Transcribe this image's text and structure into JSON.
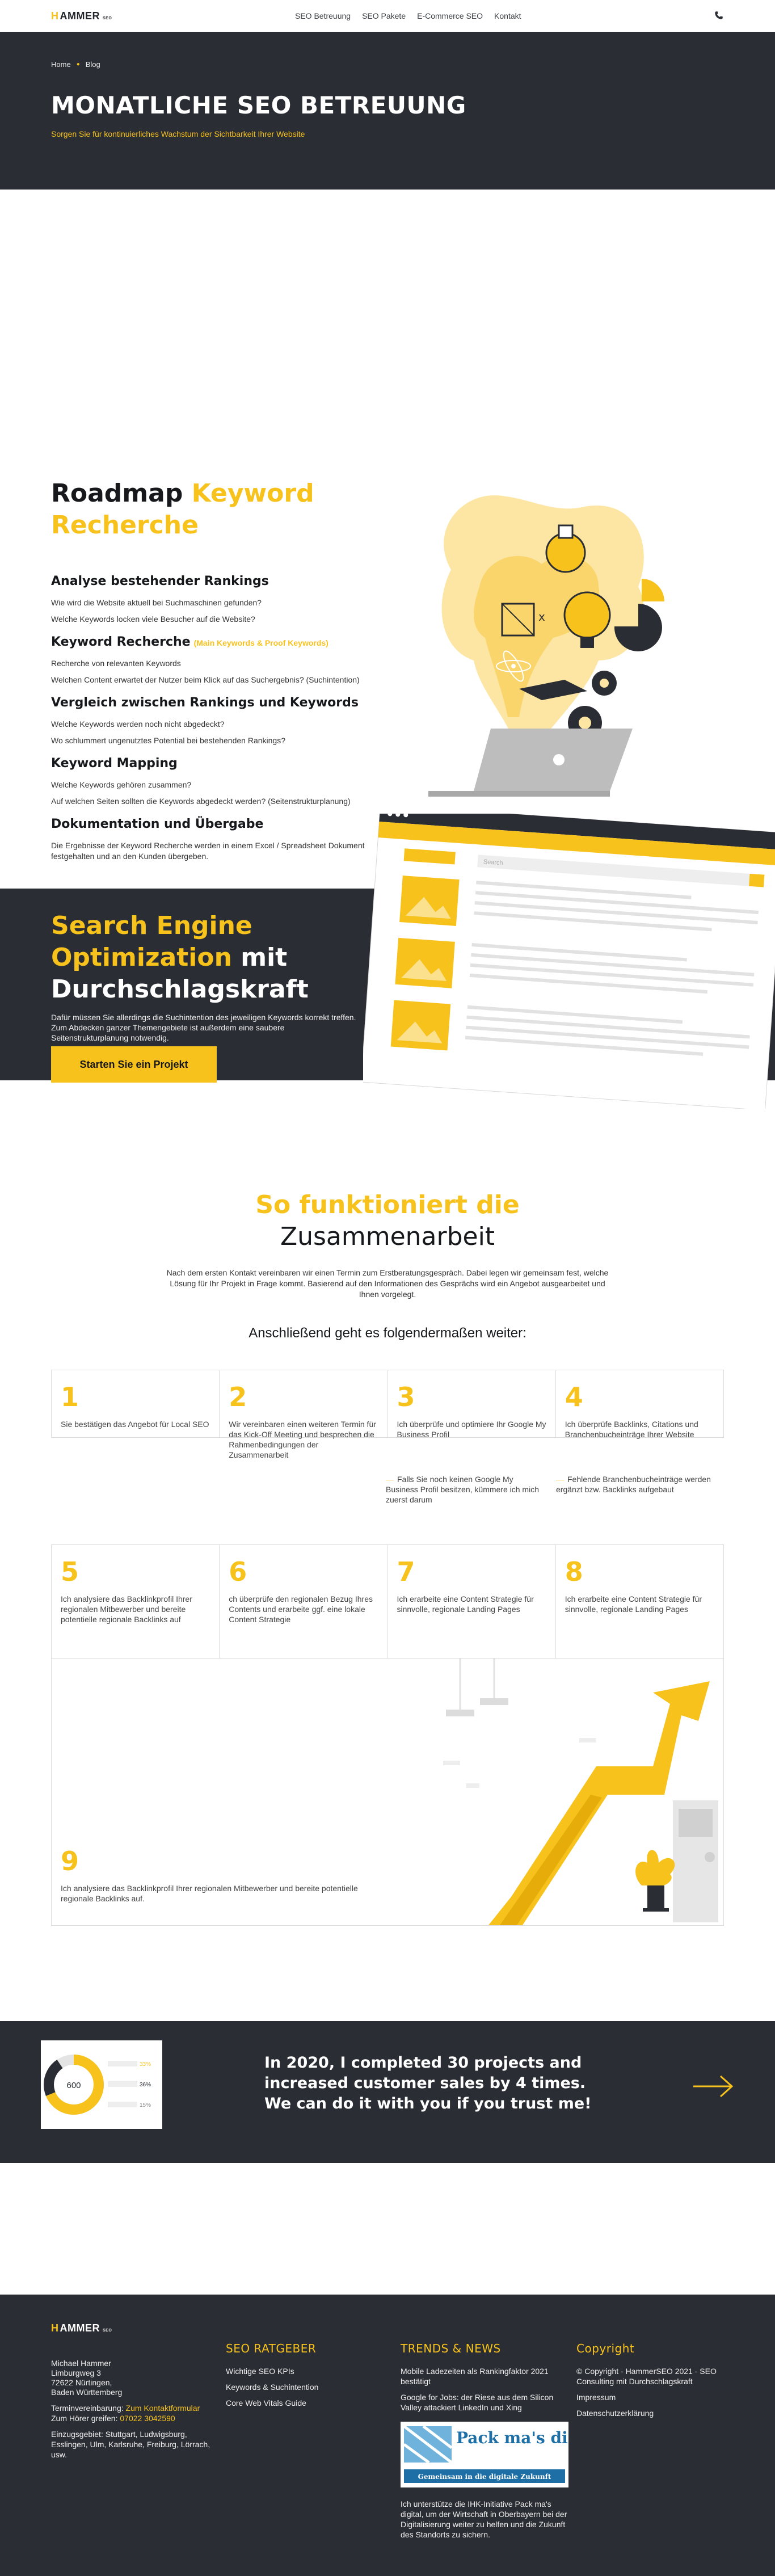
{
  "nav": {
    "logo": "HAMMER",
    "logo_sup": "SEO",
    "links": [
      "SEO Betreuung",
      "SEO Pakete",
      "E-Commerce SEO",
      "Kontakt"
    ]
  },
  "hero": {
    "breadcrumb": [
      "Home",
      "Blog"
    ],
    "title": "MONATLICHE SEO BETREUUNG",
    "subtitle": "Sorgen Sie für kontinuierliches Wachstum der Sichtbarkeit Ihrer Website"
  },
  "roadmap": {
    "title_plain": "Roadmap",
    "title_accent": "Keyword Recherche",
    "items": [
      {
        "heading": "Analyse bestehender Rankings",
        "tag": "",
        "lines": [
          "Wie wird die Website aktuell bei Suchmaschinen gefunden?",
          "Welche Keywords locken viele Besucher auf die Website?"
        ]
      },
      {
        "heading": "Keyword Recherche",
        "tag": "(Main Keywords & Proof Keywords)",
        "lines": [
          "Recherche von relevanten Keywords",
          "Welchen Content erwartet der Nutzer beim Klick auf das Suchergebnis? (Suchintention)"
        ]
      },
      {
        "heading": "Vergleich zwischen Rankings und Keywords",
        "tag": "",
        "lines": [
          "Welche Keywords werden noch nicht abgedeckt?",
          "Wo schlummert ungenutztes Potential bei bestehenden Rankings?"
        ]
      },
      {
        "heading": "Keyword Mapping",
        "tag": "",
        "lines": [
          "Welche Keywords gehören zusammen?",
          "Auf welchen Seiten sollten die Keywords abgedeckt werden? (Seitenstrukturplanung)"
        ]
      },
      {
        "heading": "Dokumentation und Übergabe",
        "tag": "",
        "lines": [
          "Die Ergebnisse der Keyword Recherche werden in einem Excel / Spreadsheet Dokument festgehalten und an den Kunden übergeben."
        ]
      }
    ]
  },
  "seo": {
    "title_accent": "Search Engine Optimization",
    "title_plain": "mit Durchschlagskraft",
    "text": "Dafür müssen Sie allerdings die Suchintention des jeweiligen Keywords korrekt treffen. Zum Abdecken ganzer Themengebiete ist außerdem eine saubere Seitenstrukturplanung notwendig.",
    "cta": "Starten Sie ein Projekt",
    "search_placeholder": "Search"
  },
  "how": {
    "title_accent": "So funktioniert die",
    "title_plain": "Zusammenarbeit",
    "intro": "Nach dem ersten Kontakt vereinbaren wir einen Termin zum Erstberatungsgespräch. Dabei legen wir gemeinsam fest, welche Lösung für Ihr Projekt in Frage kommt. Basierend auf den Informationen des Gesprächs wird ein Angebot ausgearbeitet und Ihnen vorgelegt.",
    "subtitle": "Anschließend geht es folgendermaßen weiter:",
    "steps_row1": [
      {
        "num": "1",
        "text": "Sie bestätigen das Angebot für Local SEO"
      },
      {
        "num": "2",
        "text": "Wir vereinbaren einen weiteren Termin für das Kick-Off Meeting und besprechen die Rahmenbedingungen der Zusammenarbeit"
      },
      {
        "num": "3",
        "text": "Ich überprüfe und optimiere Ihr Google My Business Profil"
      },
      {
        "num": "4",
        "text": "Ich überprüfe Backlinks, Citations und Branchenbucheinträge Ihrer Website"
      }
    ],
    "note_3": "Falls Sie noch keinen Google My Business Profil besitzen, kümmere ich mich zuerst darum",
    "note_4": "Fehlende Branchenbucheinträge werden ergänzt bzw. Backlinks aufgebaut",
    "steps_row2": [
      {
        "num": "5",
        "text": "Ich analysiere das Backlinkprofil Ihrer regionalen Mitbewerber und bereite potentielle regionale Backlinks auf"
      },
      {
        "num": "6",
        "text": "ch überprüfe den regionalen Bezug Ihres Contents und erarbeite ggf. eine lokale Content Strategie"
      },
      {
        "num": "7",
        "text": "Ich erarbeite eine Content Strategie für sinnvolle, regionale Landing Pages"
      },
      {
        "num": "8",
        "text": "Ich erarbeite eine Content Strategie für sinnvolle, regionale Landing Pages"
      }
    ],
    "step9": {
      "num": "9",
      "text": "Ich analysiere das Backlinkprofil Ihrer regionalen Mitbewerber und bereite potentielle regionale Backlinks auf."
    }
  },
  "stats": {
    "donut_value": "600",
    "rows": [
      "33%",
      "36%",
      "15%"
    ],
    "headline": "In 2020, I completed 30 projects and increased customer sales by 4 times. We can do it with you if you trust me!"
  },
  "footer": {
    "logo": "HAMMER",
    "logo_sup": "SEO",
    "address": [
      "Michael Hammer",
      "Limburgweg 3",
      "72622 Nürtingen,",
      "Baden Württemberg"
    ],
    "appointment_prefix": "Terminvereinbarung: ",
    "appointment_link": "Zum Kontaktformular",
    "appointment_mid": " Zum Hörer greifen: ",
    "phone": "07022 3042590",
    "region": "Einzugsgebiet: Stuttgart, Ludwigsburg, Esslingen, Ulm, Karlsruhe, Freiburg, Lörrach, usw.",
    "col2_title": "SEO RATGEBER",
    "col2_links": [
      "Wichtige SEO KPIs",
      "Keywords & Suchintention",
      "Core Web Vitals Guide"
    ],
    "col3_title": "TRENDS & NEWS",
    "col3_links": [
      "Mobile Ladezeiten als Rankingfaktor 2021 bestätigt",
      "Google for Jobs: der Riese aus dem Silicon Valley attackiert LinkedIn und Xing"
    ],
    "badge_title": "Pack ma's digital",
    "badge_sub": "Gemeinsam in die digitale Zukunft",
    "badge_text": "Ich unterstütze die IHK-Initiative Pack ma's digital, um der Wirtschaft in Oberbayern bei der Digitalisierung weiter zu helfen und die Zukunft des Standorts zu sichern.",
    "col4_title": "Copyright",
    "copyright": "© Copyright - HammerSEO 2021 - SEO Consulting mit Durchschlagskraft",
    "col4_links": [
      "Impressum",
      "Datenschutzerklärung"
    ]
  },
  "colors": {
    "accent": "#f7c21c",
    "dark": "#2a2d33"
  }
}
